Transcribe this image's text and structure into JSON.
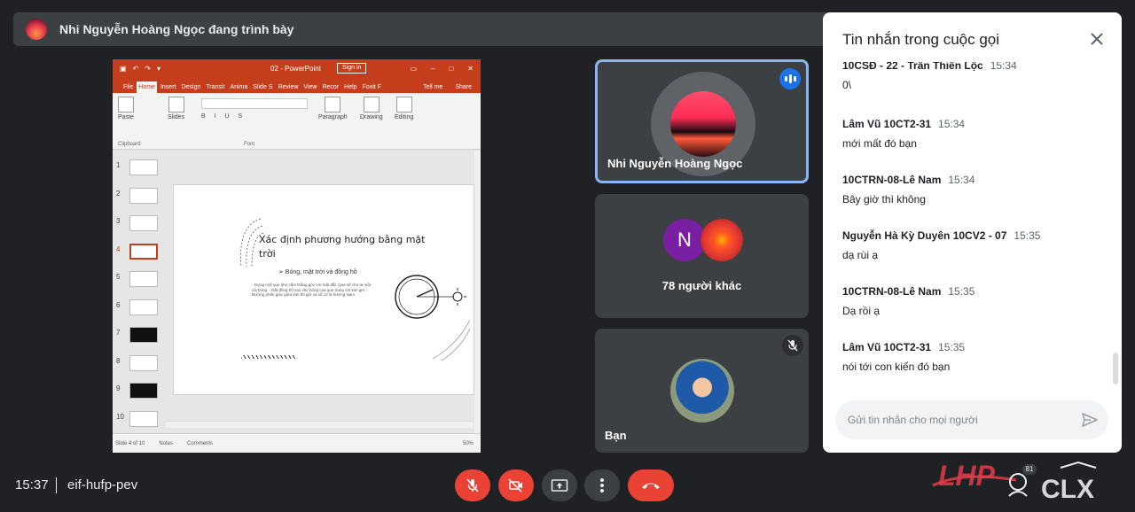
{
  "presenter": {
    "text": "Nhi Nguyễn Hoàng Ngọc đang trình bày"
  },
  "shared_screen": {
    "file_name": "02  -  PowerPoint",
    "sign_in": "Sign in",
    "tabs": [
      "File",
      "Home",
      "Insert",
      "Design",
      "Transit",
      "Anima",
      "Slide S",
      "Review",
      "View",
      "Recor",
      "Help",
      "Foxit F"
    ],
    "tell_me": "Tell me",
    "share": "Share",
    "ribbon": {
      "paste": "Paste",
      "clipboard": "Clipboard",
      "slides": "Slides",
      "font": "Font",
      "paragraph": "Paragraph",
      "drawing": "Drawing",
      "editing": "Editing"
    },
    "thumb_numbers": [
      "1",
      "2",
      "3",
      "4",
      "5",
      "6",
      "7",
      "8",
      "9",
      "10"
    ],
    "selected_slide": "4",
    "slide": {
      "title": "Xác định phương hướng bằng mặt trời",
      "subtitle": "➢ Bóng, mặt trời và đồng hồ",
      "bullets": "- Dựng một que nhỏ cắm thẳng góc với mặt đất. Que sẽ cho ta một cái bóng. - Đặt đồng hồ sao cho bóng của que trùng với kim giờ. - Đường phân giác giữa kim thì giờ và số 12 là hướng Nam."
    },
    "status": {
      "slide_of": "Slide 4 of 10",
      "notes": "Notes",
      "comments": "Comments",
      "zoom": "50%"
    }
  },
  "tiles": [
    {
      "name": "Nhi Nguyễn Hoàng Ngọc",
      "speaking": true
    },
    {
      "avatar_letter": "N",
      "label": "78 người khác"
    },
    {
      "name": "Bạn",
      "muted": true
    }
  ],
  "chat": {
    "title": "Tin nhắn trong cuộc gọi",
    "messages": [
      {
        "sender": "10CSĐ - 22 - Trần Thiên Lộc",
        "time": "15:34",
        "text": "0\\"
      },
      {
        "sender": "Lâm Vũ 10CT2-31",
        "time": "15:34",
        "text": "mới mất đó bạn"
      },
      {
        "sender": "10CTRN-08-Lê Nam",
        "time": "15:34",
        "text": "Bây giờ thì không"
      },
      {
        "sender": "Nguyễn Hà Kỳ Duyên 10CV2 - 07",
        "time": "15:35",
        "text": "dạ rùi ạ"
      },
      {
        "sender": "10CTRN-08-Lê Nam",
        "time": "15:35",
        "text": "Dạ rồi ạ"
      },
      {
        "sender": "Lâm Vũ 10CT2-31",
        "time": "15:35",
        "text": "nói tới con kiến đó bạn"
      }
    ],
    "input_placeholder": "Gửi tin nhắn cho mọi người"
  },
  "bottom": {
    "time": "15:37",
    "meeting_code": "eif-hufp-pev",
    "people_count": "81"
  },
  "colors": {
    "background": "#202124",
    "tile": "#3c4043",
    "danger": "#ea4335",
    "accent": "#8ab4f8",
    "powerpoint": "#c43e1c"
  }
}
